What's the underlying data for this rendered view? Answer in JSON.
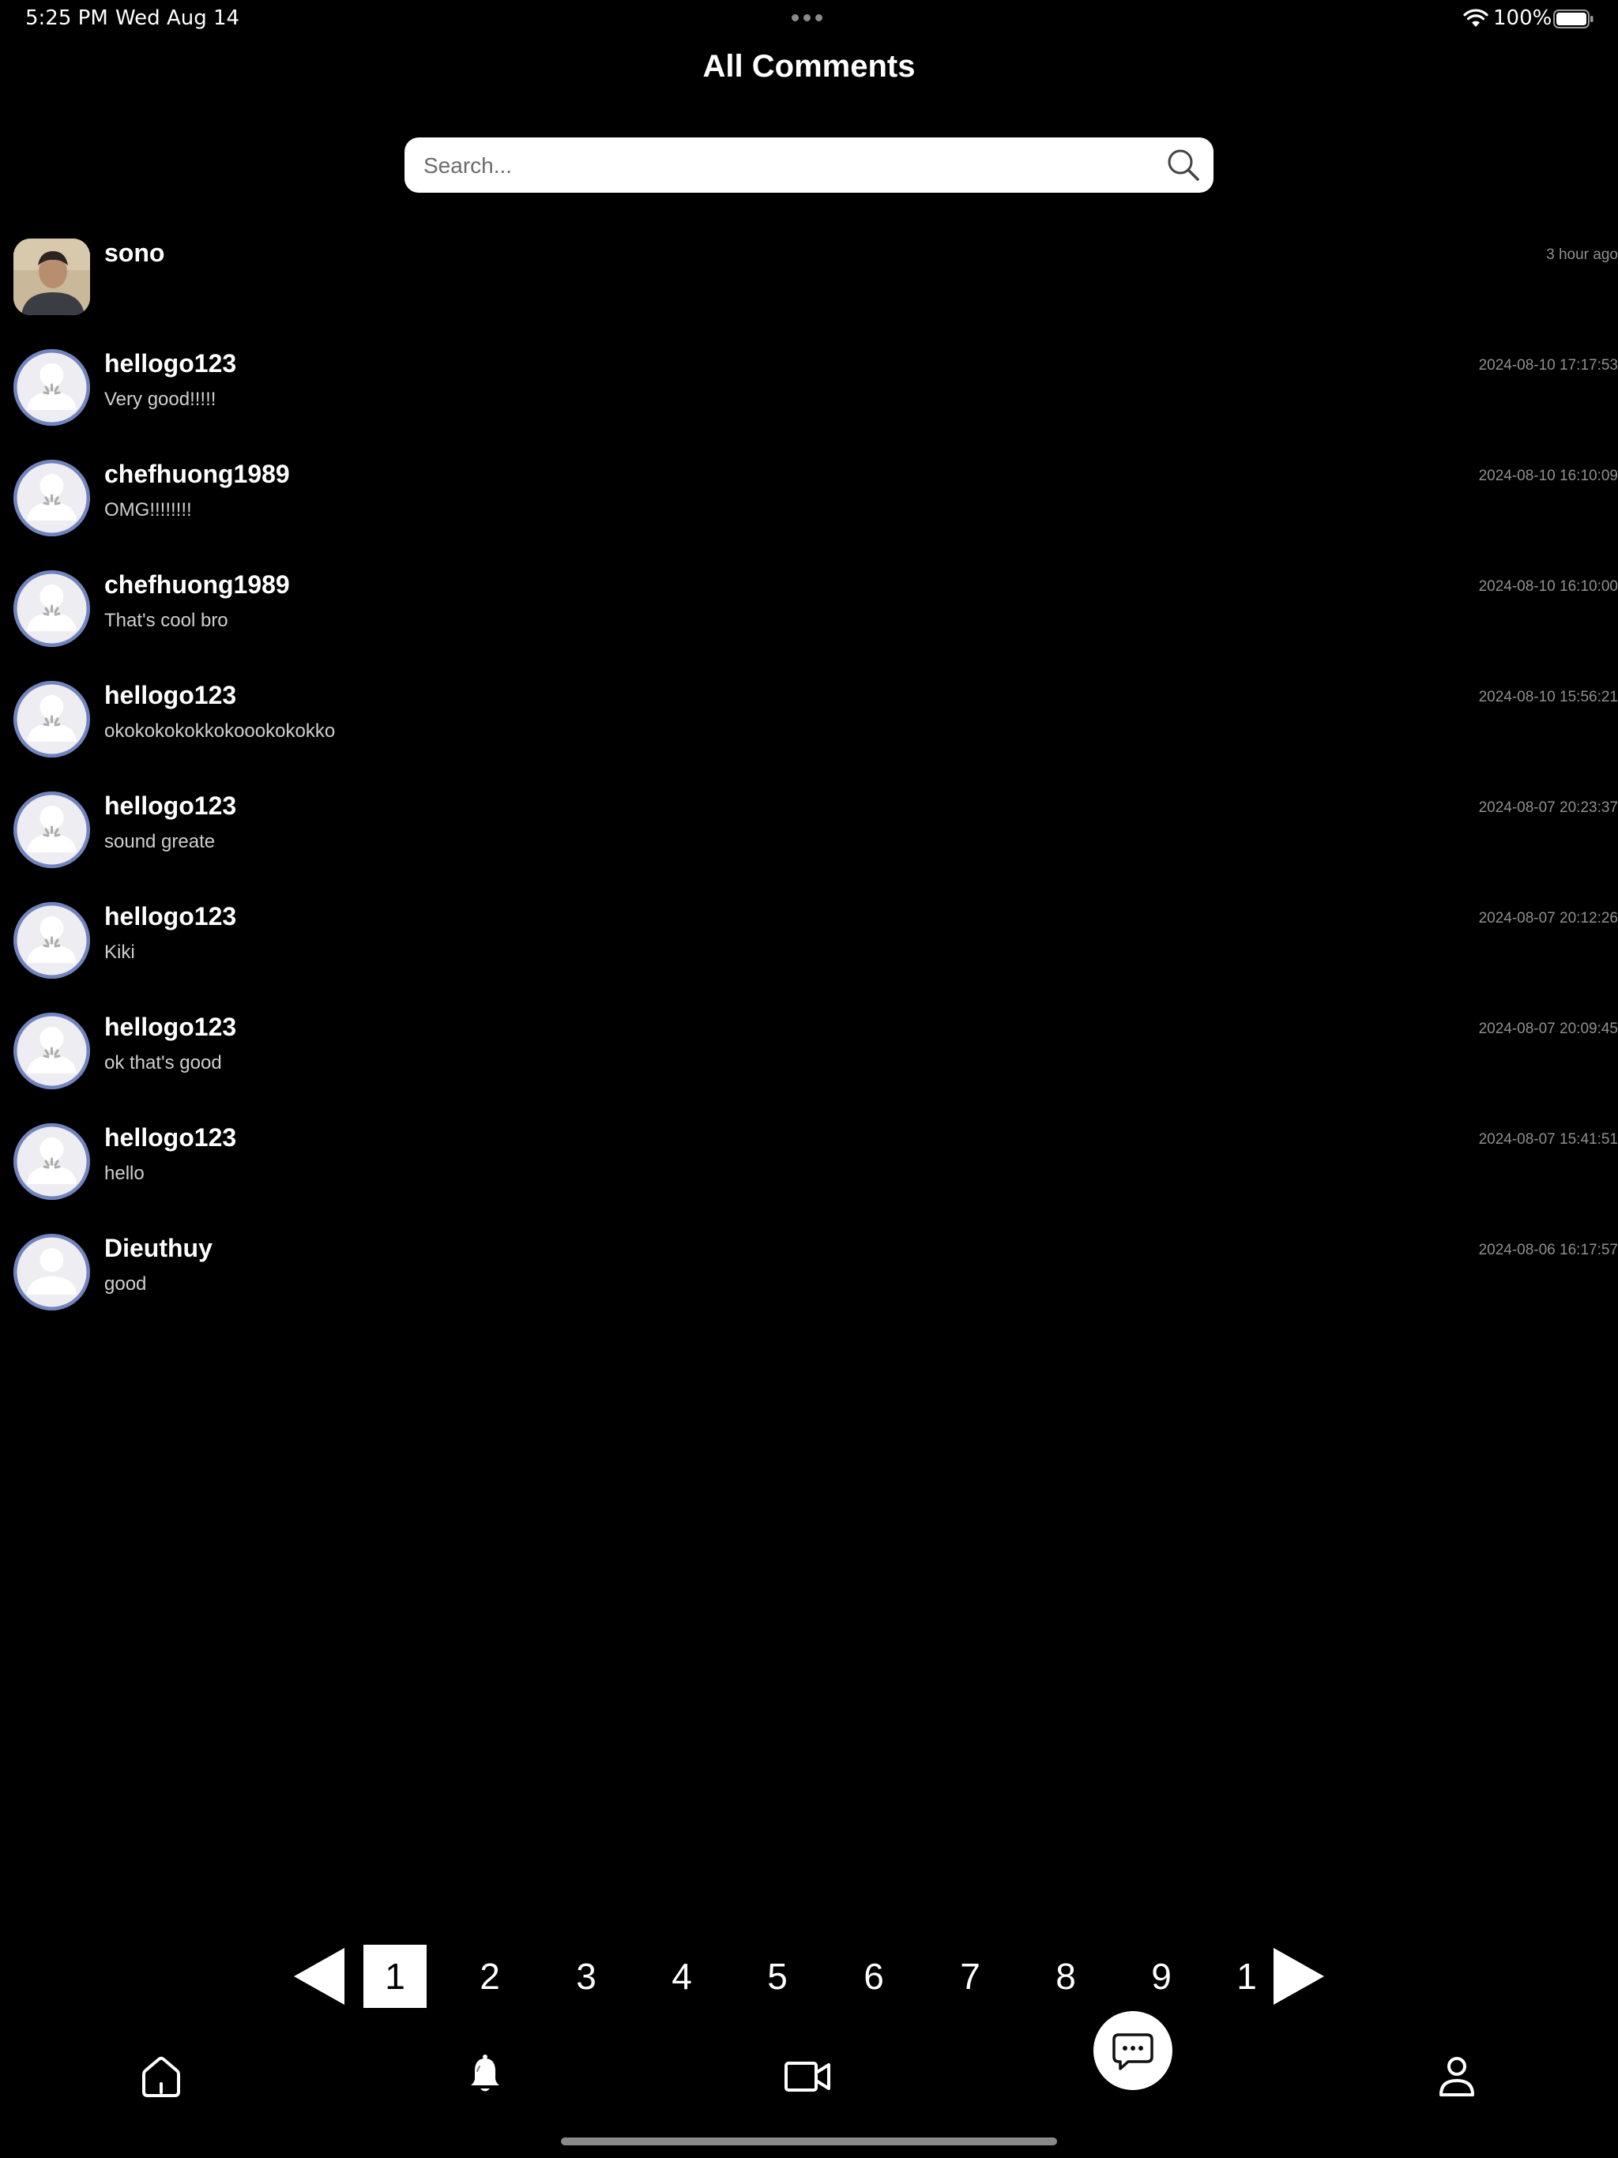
{
  "status_bar": {
    "time": "5:25 PM",
    "date": "Wed Aug 14",
    "battery": "100%",
    "icons": [
      "wifi-icon",
      "battery-icon"
    ]
  },
  "header": {
    "title": "All Comments"
  },
  "search": {
    "placeholder": "Search...",
    "value": "",
    "icon": "search-icon"
  },
  "comments": [
    {
      "username": "sono",
      "text": "",
      "timestamp": "3 hour ago",
      "avatar": "photo"
    },
    {
      "username": "hellogo123",
      "text": "Very good!!!!!",
      "timestamp": "2024-08-10 17:17:53",
      "avatar": "default"
    },
    {
      "username": "chefhuong1989",
      "text": "OMG!!!!!!!!",
      "timestamp": "2024-08-10 16:10:09",
      "avatar": "default"
    },
    {
      "username": "chefhuong1989",
      "text": "That's cool bro",
      "timestamp": "2024-08-10 16:10:00",
      "avatar": "default"
    },
    {
      "username": "hellogo123",
      "text": "okokokokokkokoookokokko",
      "timestamp": "2024-08-10 15:56:21",
      "avatar": "default"
    },
    {
      "username": "hellogo123",
      "text": "sound greate",
      "timestamp": "2024-08-07 20:23:37",
      "avatar": "default"
    },
    {
      "username": "hellogo123",
      "text": "Kiki",
      "timestamp": "2024-08-07 20:12:26",
      "avatar": "default"
    },
    {
      "username": "hellogo123",
      "text": "ok that's good",
      "timestamp": "2024-08-07 20:09:45",
      "avatar": "default"
    },
    {
      "username": "hellogo123",
      "text": "hello",
      "timestamp": "2024-08-07 15:41:51",
      "avatar": "default"
    },
    {
      "username": "Dieuthuy",
      "text": "good",
      "timestamp": "2024-08-06 16:17:57",
      "avatar": "default"
    }
  ],
  "pagination": {
    "pages": [
      "1",
      "2",
      "3",
      "4",
      "5",
      "6",
      "7",
      "8",
      "9",
      "1"
    ],
    "current": "1",
    "icons": [
      "previous-page-icon",
      "next-page-icon"
    ]
  },
  "bottom_nav": {
    "items": [
      "home-icon",
      "notification-bell-icon",
      "video-camera-icon",
      "chat-bubble-icon",
      "profile-icon"
    ],
    "active": "chat-bubble-icon"
  },
  "colors": {
    "background": "#000000",
    "avatar_default": "#7184bf",
    "timestamp": "#8f8f8f",
    "comment_text": "#cfcfcf"
  }
}
